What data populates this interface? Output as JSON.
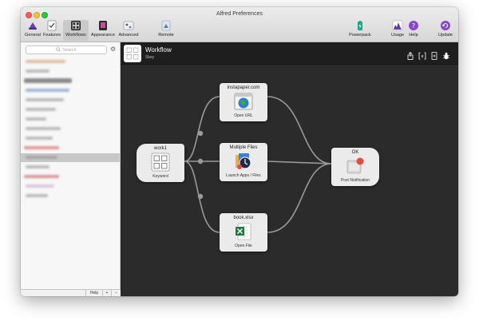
{
  "app": {
    "window_title": "Alfred Preferences"
  },
  "toolbar": {
    "general": "General",
    "features": "Features",
    "workflows": "Workflows",
    "appearance": "Appearance",
    "advanced": "Advanced",
    "remote": "Remote",
    "powerpack": "Powerpack",
    "usage": "Usage",
    "help": "Help",
    "update": "Update"
  },
  "sidebar": {
    "search_placeholder": "Search",
    "help_label": "Help",
    "add_label": "+",
    "remove_label": "−"
  },
  "workflow": {
    "title": "Workflow",
    "subtitle": "Skey"
  },
  "nodes": {
    "keyword": {
      "title": "work1",
      "sub": "Keyword"
    },
    "open_url": {
      "title": "instapaper.com",
      "sub": "Open URL"
    },
    "launch_apps": {
      "title": "Multiple Files",
      "sub": "Launch Apps / Files"
    },
    "open_file": {
      "title": "book.xlsx",
      "sub": "Open File"
    },
    "notification": {
      "title": "OK",
      "sub": "Post Notification"
    }
  },
  "colors": {
    "canvas_bg": "#2b2b2b",
    "header_bg": "#1e1e1e",
    "node_bg": "#ebebeb",
    "connection": "#9a9a9a"
  }
}
